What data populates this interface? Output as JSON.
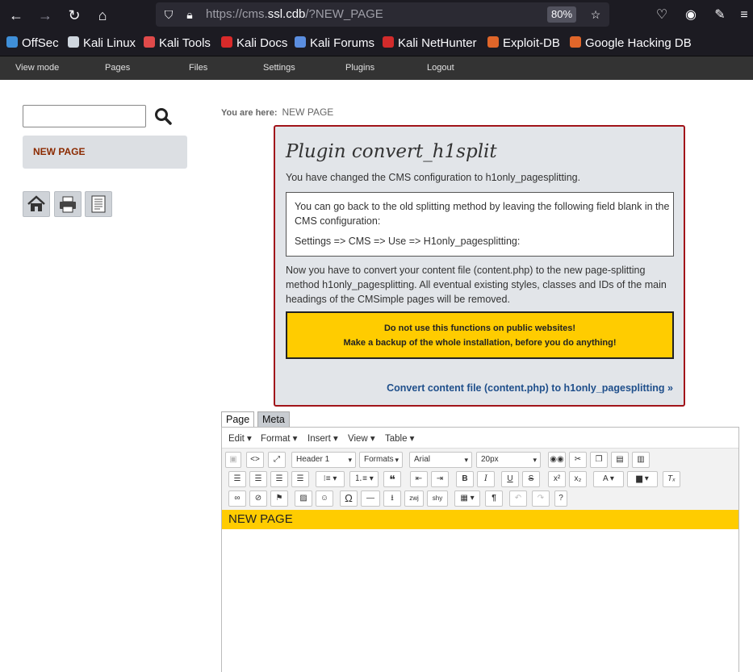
{
  "browser": {
    "url_prefix": "https://cms.",
    "url_domain": "ssl.cdb",
    "url_path": "/?NEW_PAGE",
    "zoom": "80%"
  },
  "bookmarks": [
    {
      "label": "OffSec",
      "icon": "offsec-icon",
      "color": "#3f8fd8"
    },
    {
      "label": "Kali Linux",
      "icon": "kali-dragon-icon",
      "color": "#cfd6de"
    },
    {
      "label": "Kali Tools",
      "icon": "kali-tools-icon",
      "color": "#e04a4a"
    },
    {
      "label": "Kali Docs",
      "icon": "kali-docs-icon",
      "color": "#d92a2a"
    },
    {
      "label": "Kali Forums",
      "icon": "kali-forums-icon",
      "color": "#5b8ee0"
    },
    {
      "label": "Kali NetHunter",
      "icon": "nethunter-icon",
      "color": "#d22b2b"
    },
    {
      "label": "Exploit-DB",
      "icon": "exploit-db-icon",
      "color": "#e0662a"
    },
    {
      "label": "Google Hacking DB",
      "icon": "ghdb-icon",
      "color": "#e0662a"
    }
  ],
  "cms_menu": [
    "View mode",
    "Pages",
    "Files",
    "Settings",
    "Plugins",
    "Logout"
  ],
  "sidebar": {
    "search_placeholder": "",
    "nav_item": "NEW PAGE"
  },
  "breadcrumb": {
    "label": "You are here:",
    "page": "NEW PAGE"
  },
  "plugin": {
    "title": "Plugin convert_h1split",
    "p1": "You have changed the CMS configuration to h1only_pagesplitting.",
    "box_line1": "You can go back to the old splitting method by leaving the following field blank in the CMS configuration:",
    "box_line2": "Settings => CMS => Use => H1only_pagesplitting:",
    "p2": "Now you have to convert your content file (content.php) to the new page-splitting method h1only_pagesplitting. All eventual existing styles, classes and IDs of the main headings of the CMSimple pages will be removed.",
    "warning1": "Do not use this functions on public websites!",
    "warning2": "Make a backup of the whole installation, before you do anything!",
    "convert_link": "Convert content file (content.php) to h1only_pagesplitting »"
  },
  "editor": {
    "tabs": [
      "Page",
      "Meta"
    ],
    "menus": [
      "Edit ▾",
      "Format ▾",
      "Insert ▾",
      "View ▾",
      "Table ▾"
    ],
    "block_format": "Header 1",
    "formats": "Formats",
    "font": "Arial",
    "size": "20px",
    "zwj": "zwj",
    "shy": "shy",
    "help": "?",
    "heading_text": "NEW PAGE"
  },
  "colors": {
    "accent_red": "#a1141a",
    "warning_yellow": "#ffcc00",
    "link_blue": "#1f4f8b"
  }
}
